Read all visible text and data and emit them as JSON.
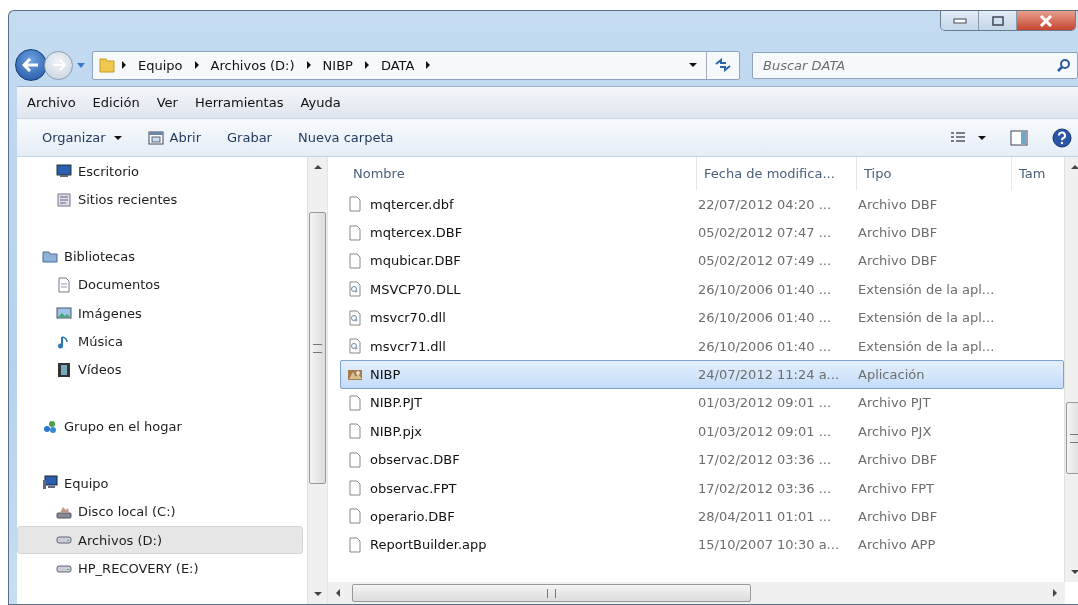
{
  "address": {
    "crumbs": [
      "Equipo",
      "Archivos (D:)",
      "NIBP",
      "DATA"
    ]
  },
  "search": {
    "placeholder": "Buscar DATA"
  },
  "menu": [
    "Archivo",
    "Edición",
    "Ver",
    "Herramientas",
    "Ayuda"
  ],
  "toolbar": [
    {
      "label": "Organizar",
      "kind": "dropdown"
    },
    {
      "label": "Abrir",
      "kind": "open"
    },
    {
      "label": "Grabar",
      "kind": "plain"
    },
    {
      "label": "Nueva carpeta",
      "kind": "plain"
    }
  ],
  "sidebar": {
    "groups": [
      {
        "items": [
          {
            "label": "Escritorio",
            "kind": "desktop",
            "selected": false
          },
          {
            "label": "Sitios recientes",
            "kind": "recent",
            "selected": false
          }
        ]
      },
      {
        "label": "Bibliotecas",
        "kind": "library",
        "selected": false,
        "children": [
          {
            "label": "Documentos",
            "kind": "document",
            "selected": false
          },
          {
            "label": "Imágenes",
            "kind": "image",
            "selected": false
          },
          {
            "label": "Música",
            "kind": "music",
            "selected": false
          },
          {
            "label": "Vídeos",
            "kind": "video",
            "selected": false
          }
        ]
      },
      {
        "label": "Grupo en el hogar",
        "kind": "homegroup",
        "selected": false
      },
      {
        "label": "Equipo",
        "kind": "computer",
        "selected": false,
        "children": [
          {
            "label": "Disco local (C:)",
            "kind": "sysdrive",
            "selected": false
          },
          {
            "label": "Archivos (D:)",
            "kind": "drive",
            "selected": true
          },
          {
            "label": "HP_RECOVERY (E:)",
            "kind": "drive",
            "selected": false
          }
        ]
      }
    ]
  },
  "table": {
    "columns": [
      "Nombre",
      "Fecha de modifica...",
      "Tipo",
      "Tam"
    ],
    "rows": [
      {
        "name": "mqtercer.dbf",
        "date": "22/07/2012 04:20 ...",
        "type": "Archivo DBF",
        "kind": "blank",
        "selected": false
      },
      {
        "name": "mqtercex.DBF",
        "date": "05/02/2012 07:47 ...",
        "type": "Archivo DBF",
        "kind": "blank",
        "selected": false
      },
      {
        "name": "mqubicar.DBF",
        "date": "05/02/2012 07:49 ...",
        "type": "Archivo DBF",
        "kind": "blank",
        "selected": false
      },
      {
        "name": "MSVCP70.DLL",
        "date": "26/10/2006 01:40 ...",
        "type": "Extensión de la apl...",
        "kind": "dll",
        "selected": false
      },
      {
        "name": "msvcr70.dll",
        "date": "26/10/2006 01:40 ...",
        "type": "Extensión de la apl...",
        "kind": "dll",
        "selected": false
      },
      {
        "name": "msvcr71.dll",
        "date": "26/10/2006 01:40 ...",
        "type": "Extensión de la apl...",
        "kind": "dll",
        "selected": false
      },
      {
        "name": "NIBP",
        "date": "24/07/2012 11:24 a...",
        "type": "Aplicación",
        "kind": "app",
        "selected": true
      },
      {
        "name": "NIBP.PJT",
        "date": "01/03/2012 09:01 ...",
        "type": "Archivo PJT",
        "kind": "blank",
        "selected": false
      },
      {
        "name": "NIBP.pjx",
        "date": "01/03/2012 09:01 ...",
        "type": "Archivo PJX",
        "kind": "blank",
        "selected": false
      },
      {
        "name": "observac.DBF",
        "date": "17/02/2012 03:36 ...",
        "type": "Archivo DBF",
        "kind": "blank",
        "selected": false
      },
      {
        "name": "observac.FPT",
        "date": "17/02/2012 03:36 ...",
        "type": "Archivo FPT",
        "kind": "blank",
        "selected": false
      },
      {
        "name": "operario.DBF",
        "date": "28/04/2011 01:01 ...",
        "type": "Archivo DBF",
        "kind": "blank",
        "selected": false
      },
      {
        "name": "ReportBuilder.app",
        "date": "15/10/2007 10:30 a...",
        "type": "Archivo APP",
        "kind": "blank",
        "selected": false
      }
    ]
  }
}
